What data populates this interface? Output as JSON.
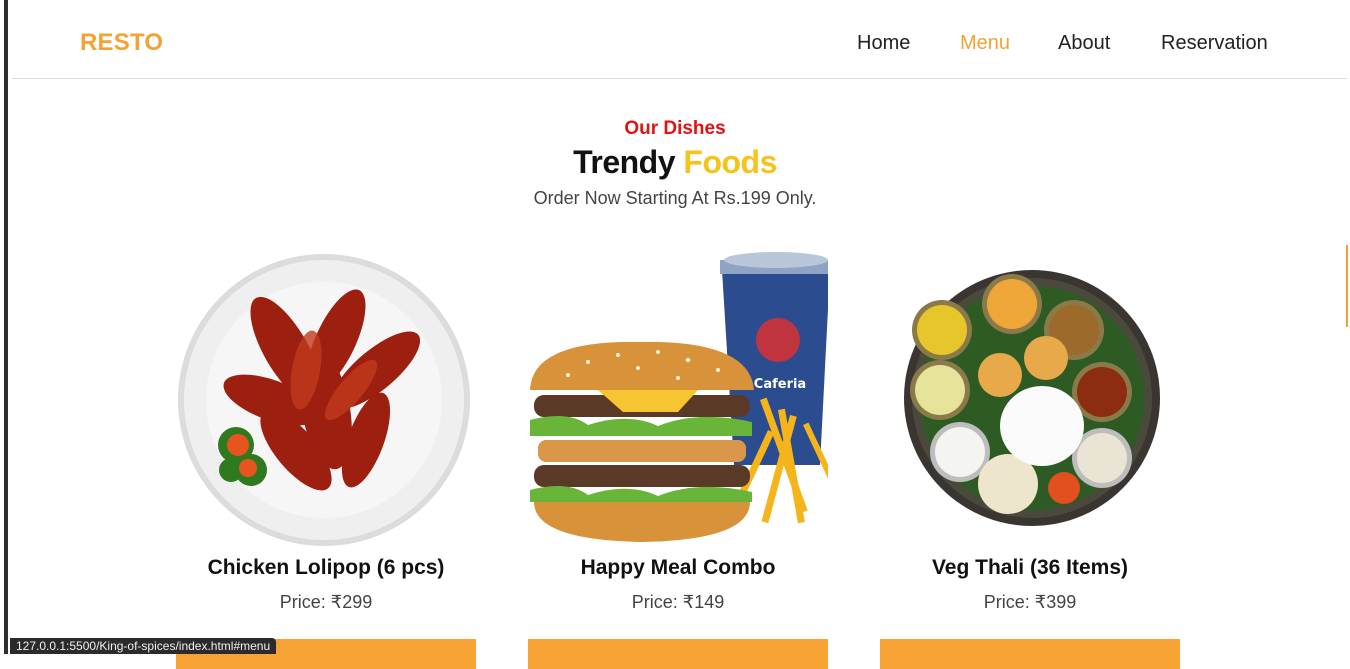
{
  "brand": {
    "name": "RESTO",
    "color": "#f4a233"
  },
  "nav": {
    "items": [
      {
        "label": "Home",
        "active": false
      },
      {
        "label": "Menu",
        "active": true
      },
      {
        "label": "About",
        "active": false
      },
      {
        "label": "Reservation",
        "active": false
      }
    ]
  },
  "section": {
    "eyebrow": "Our Dishes",
    "heading_part1": "Trendy",
    "heading_part2": "Foods",
    "subheading": "Order Now Starting At Rs.199 Only."
  },
  "dishes": [
    {
      "name": "Chicken Lolipop (6 pcs)",
      "price": "Price: ₹299",
      "image": "chicken-lollipop-plate"
    },
    {
      "name": "Happy Meal Combo",
      "price": "Price: ₹149",
      "image": "burger-combo-with-drink"
    },
    {
      "name": "Veg Thali (36 Items)",
      "price": "Price: ₹399",
      "image": "veg-thali-platter"
    }
  ],
  "cup_brand": "Caferia",
  "status_bar": {
    "url": "127.0.0.1:5500/King-of-spices/index.html#menu"
  },
  "colors": {
    "accent": "#f4a233",
    "eyebrow": "#e01212",
    "heading_accent": "#f6c21c"
  }
}
